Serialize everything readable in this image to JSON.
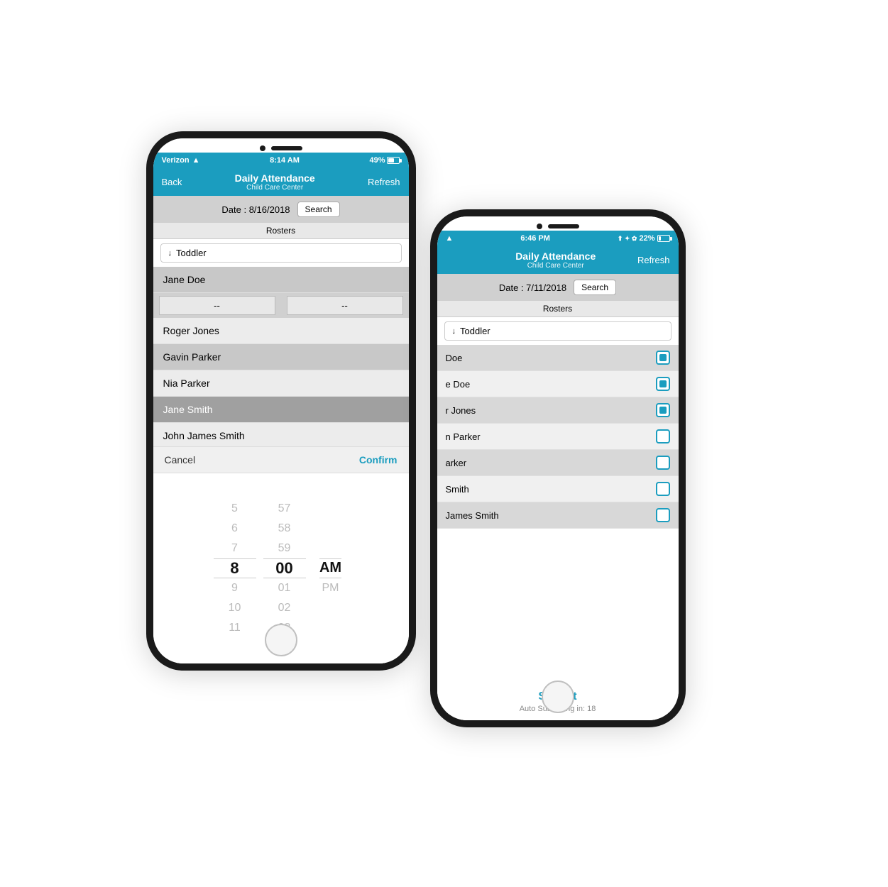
{
  "phone1": {
    "status": {
      "carrier": "Verizon",
      "time": "8:14 AM",
      "battery": "49%",
      "wifi": true
    },
    "header": {
      "back_label": "Back",
      "title": "Daily Attendance",
      "subtitle": "Child Care Center",
      "refresh_label": "Refresh"
    },
    "date_label": "Date : 8/16/2018",
    "search_label": "Search",
    "rosters_label": "Rosters",
    "dropdown_label": "Toddler",
    "students": [
      {
        "name": "Jane Doe",
        "style": "alt"
      },
      {
        "name": "Roger Jones",
        "style": "normal"
      },
      {
        "name": "Gavin Parker",
        "style": "alt"
      },
      {
        "name": "Nia Parker",
        "style": "normal"
      },
      {
        "name": "Jane Smith",
        "style": "selected"
      },
      {
        "name": "John James Smith",
        "style": "normal"
      }
    ],
    "time_row": {
      "cell1": "--",
      "cell2": "--"
    },
    "action": {
      "cancel": "Cancel",
      "confirm": "Confirm"
    },
    "time_picker": {
      "hours": [
        "5",
        "6",
        "7",
        "8",
        "9",
        "10",
        "11"
      ],
      "minutes": [
        "57",
        "58",
        "59",
        "00",
        "01",
        "02",
        "03"
      ],
      "ampm": [
        "",
        "",
        "",
        "AM",
        "PM",
        "",
        ""
      ],
      "selected_hour": "8",
      "selected_minute": "00",
      "selected_ampm": "AM"
    }
  },
  "phone2": {
    "status": {
      "time": "6:46 PM",
      "battery": "22%",
      "wifi": true
    },
    "header": {
      "title": "Daily Attendance",
      "subtitle": "Child Care Center",
      "refresh_label": "Refresh"
    },
    "date_label": "Date : 7/11/2018",
    "search_label": "Search",
    "rosters_label": "Rosters",
    "dropdown_label": "Toddler",
    "students": [
      {
        "name": "Doe",
        "checked": true,
        "style": "alt"
      },
      {
        "name": "e Doe",
        "checked": true,
        "style": "normal"
      },
      {
        "name": "r Jones",
        "checked": true,
        "style": "alt"
      },
      {
        "name": "n Parker",
        "checked": false,
        "style": "normal"
      },
      {
        "name": "arker",
        "checked": false,
        "style": "alt"
      },
      {
        "name": "Smith",
        "checked": false,
        "style": "normal"
      },
      {
        "name": "James Smith",
        "checked": false,
        "style": "alt"
      }
    ],
    "submit_label": "Submit",
    "auto_submit_text": "Auto Submitting in: 18"
  }
}
